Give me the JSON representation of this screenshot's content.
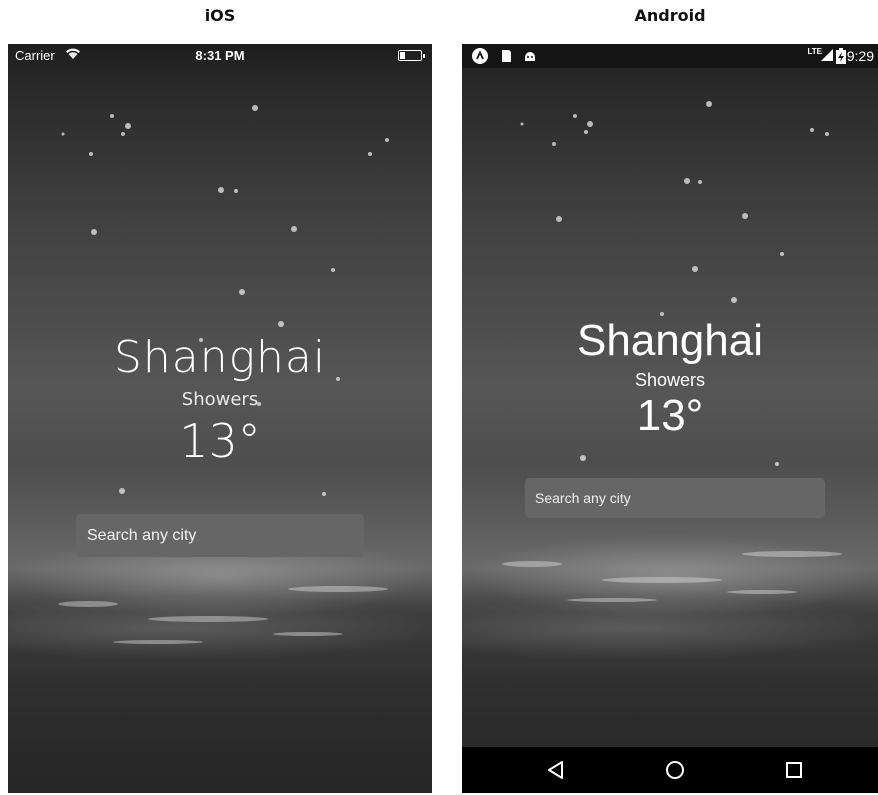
{
  "labels": {
    "ios": "iOS",
    "android": "Android"
  },
  "ios": {
    "status_bar": {
      "carrier": "Carrier",
      "time": "8:31 PM",
      "icons": [
        "wifi-icon",
        "battery-icon"
      ]
    },
    "weather": {
      "city": "Shanghai",
      "condition": "Showers",
      "temperature": "13°"
    },
    "search": {
      "placeholder": "Search any city",
      "value": ""
    }
  },
  "android": {
    "status_bar": {
      "time": "9:29",
      "network": "LTE",
      "icons": [
        "app-a-icon",
        "sd-card-icon",
        "android-icon",
        "signal-icon",
        "battery-charging-icon"
      ]
    },
    "weather": {
      "city": "Shanghai",
      "condition": "Showers",
      "temperature": "13°"
    },
    "search": {
      "placeholder": "Search any city",
      "value": ""
    },
    "nav_bar": {
      "icons": [
        "back-icon",
        "home-icon",
        "recents-icon"
      ]
    }
  },
  "colors": {
    "search_bg": "#666666",
    "text": "#ffffff",
    "android_status_bg": "#141414",
    "android_nav_bg": "#000000"
  }
}
